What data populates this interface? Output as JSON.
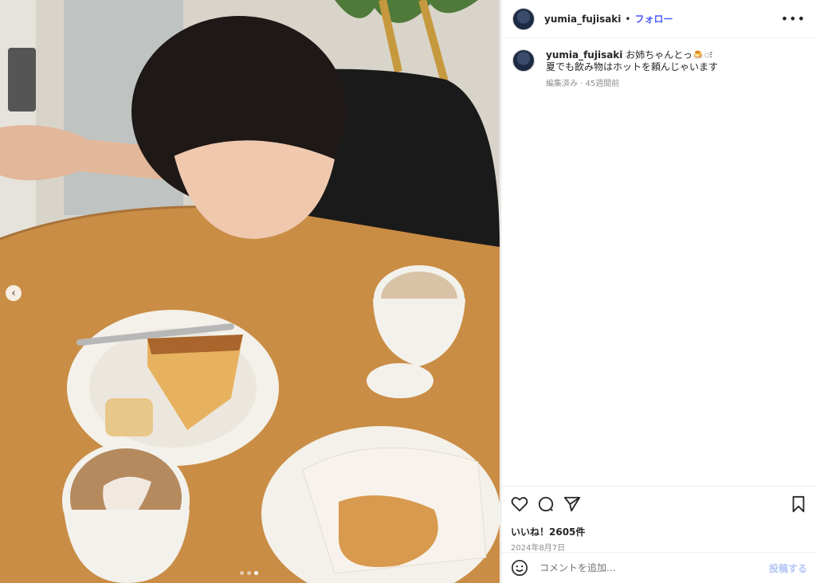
{
  "post": {
    "username": "yumia_fujisaki",
    "separator": "•",
    "follow_label": "フォロー",
    "more_label": "•••",
    "nav_prev": "‹"
  },
  "caption": {
    "username": "yumia_fujisaki",
    "line1": "お姉ちゃんとっ🍮ः",
    "line2": "夏でも飲み物はホットを頼んじゃいます",
    "meta": "編集済み · 45週間前"
  },
  "actions": {
    "likes": "いいね！2605件",
    "date": "2024年8月7日"
  },
  "comment": {
    "placeholder": "コメントを追加...",
    "post_label": "投稿する"
  },
  "carousel": {
    "count": 3,
    "active": 3
  },
  "icons": [
    "heart-icon",
    "comment-icon",
    "share-icon",
    "bookmark-icon",
    "emoji-icon",
    "more-icon"
  ],
  "colors": {
    "accent": "#4a5df9",
    "post_disabled": "#b3c5f5",
    "meta": "#8e8e8e"
  }
}
